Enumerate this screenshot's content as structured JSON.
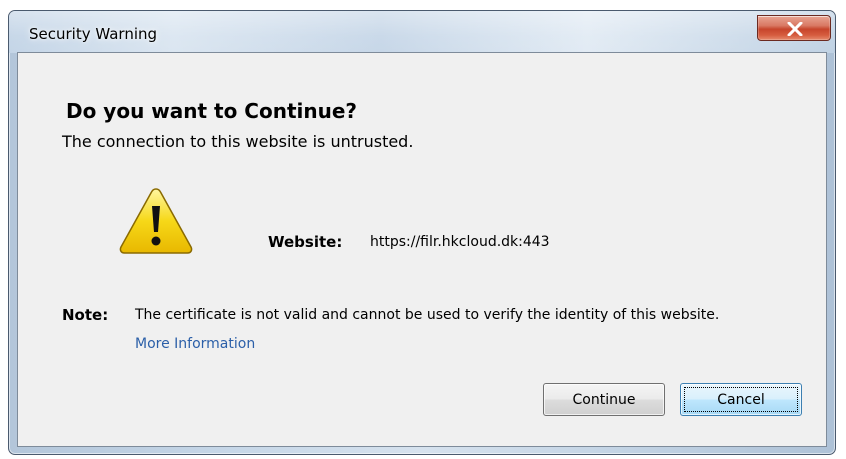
{
  "window": {
    "title": "Security Warning",
    "close_glyph": "X"
  },
  "dialog": {
    "heading": "Do you want to Continue?",
    "subheading": "The connection to this website is untrusted.",
    "warning_icon": "warning-triangle-icon",
    "website_label": "Website:",
    "website_url": "https://filr.hkcloud.dk:443",
    "note_label": "Note:",
    "note_text": "The certificate is not valid and cannot be used to verify the identity of this website.",
    "more_info_link": "More Information"
  },
  "buttons": {
    "continue_label": "Continue",
    "cancel_label": "Cancel",
    "focused": "Cancel"
  },
  "colors": {
    "link": "#2b5fa8",
    "close_button": "#c7452c",
    "warning_fill": "#f6d818",
    "content_background": "#f0f0f0"
  }
}
